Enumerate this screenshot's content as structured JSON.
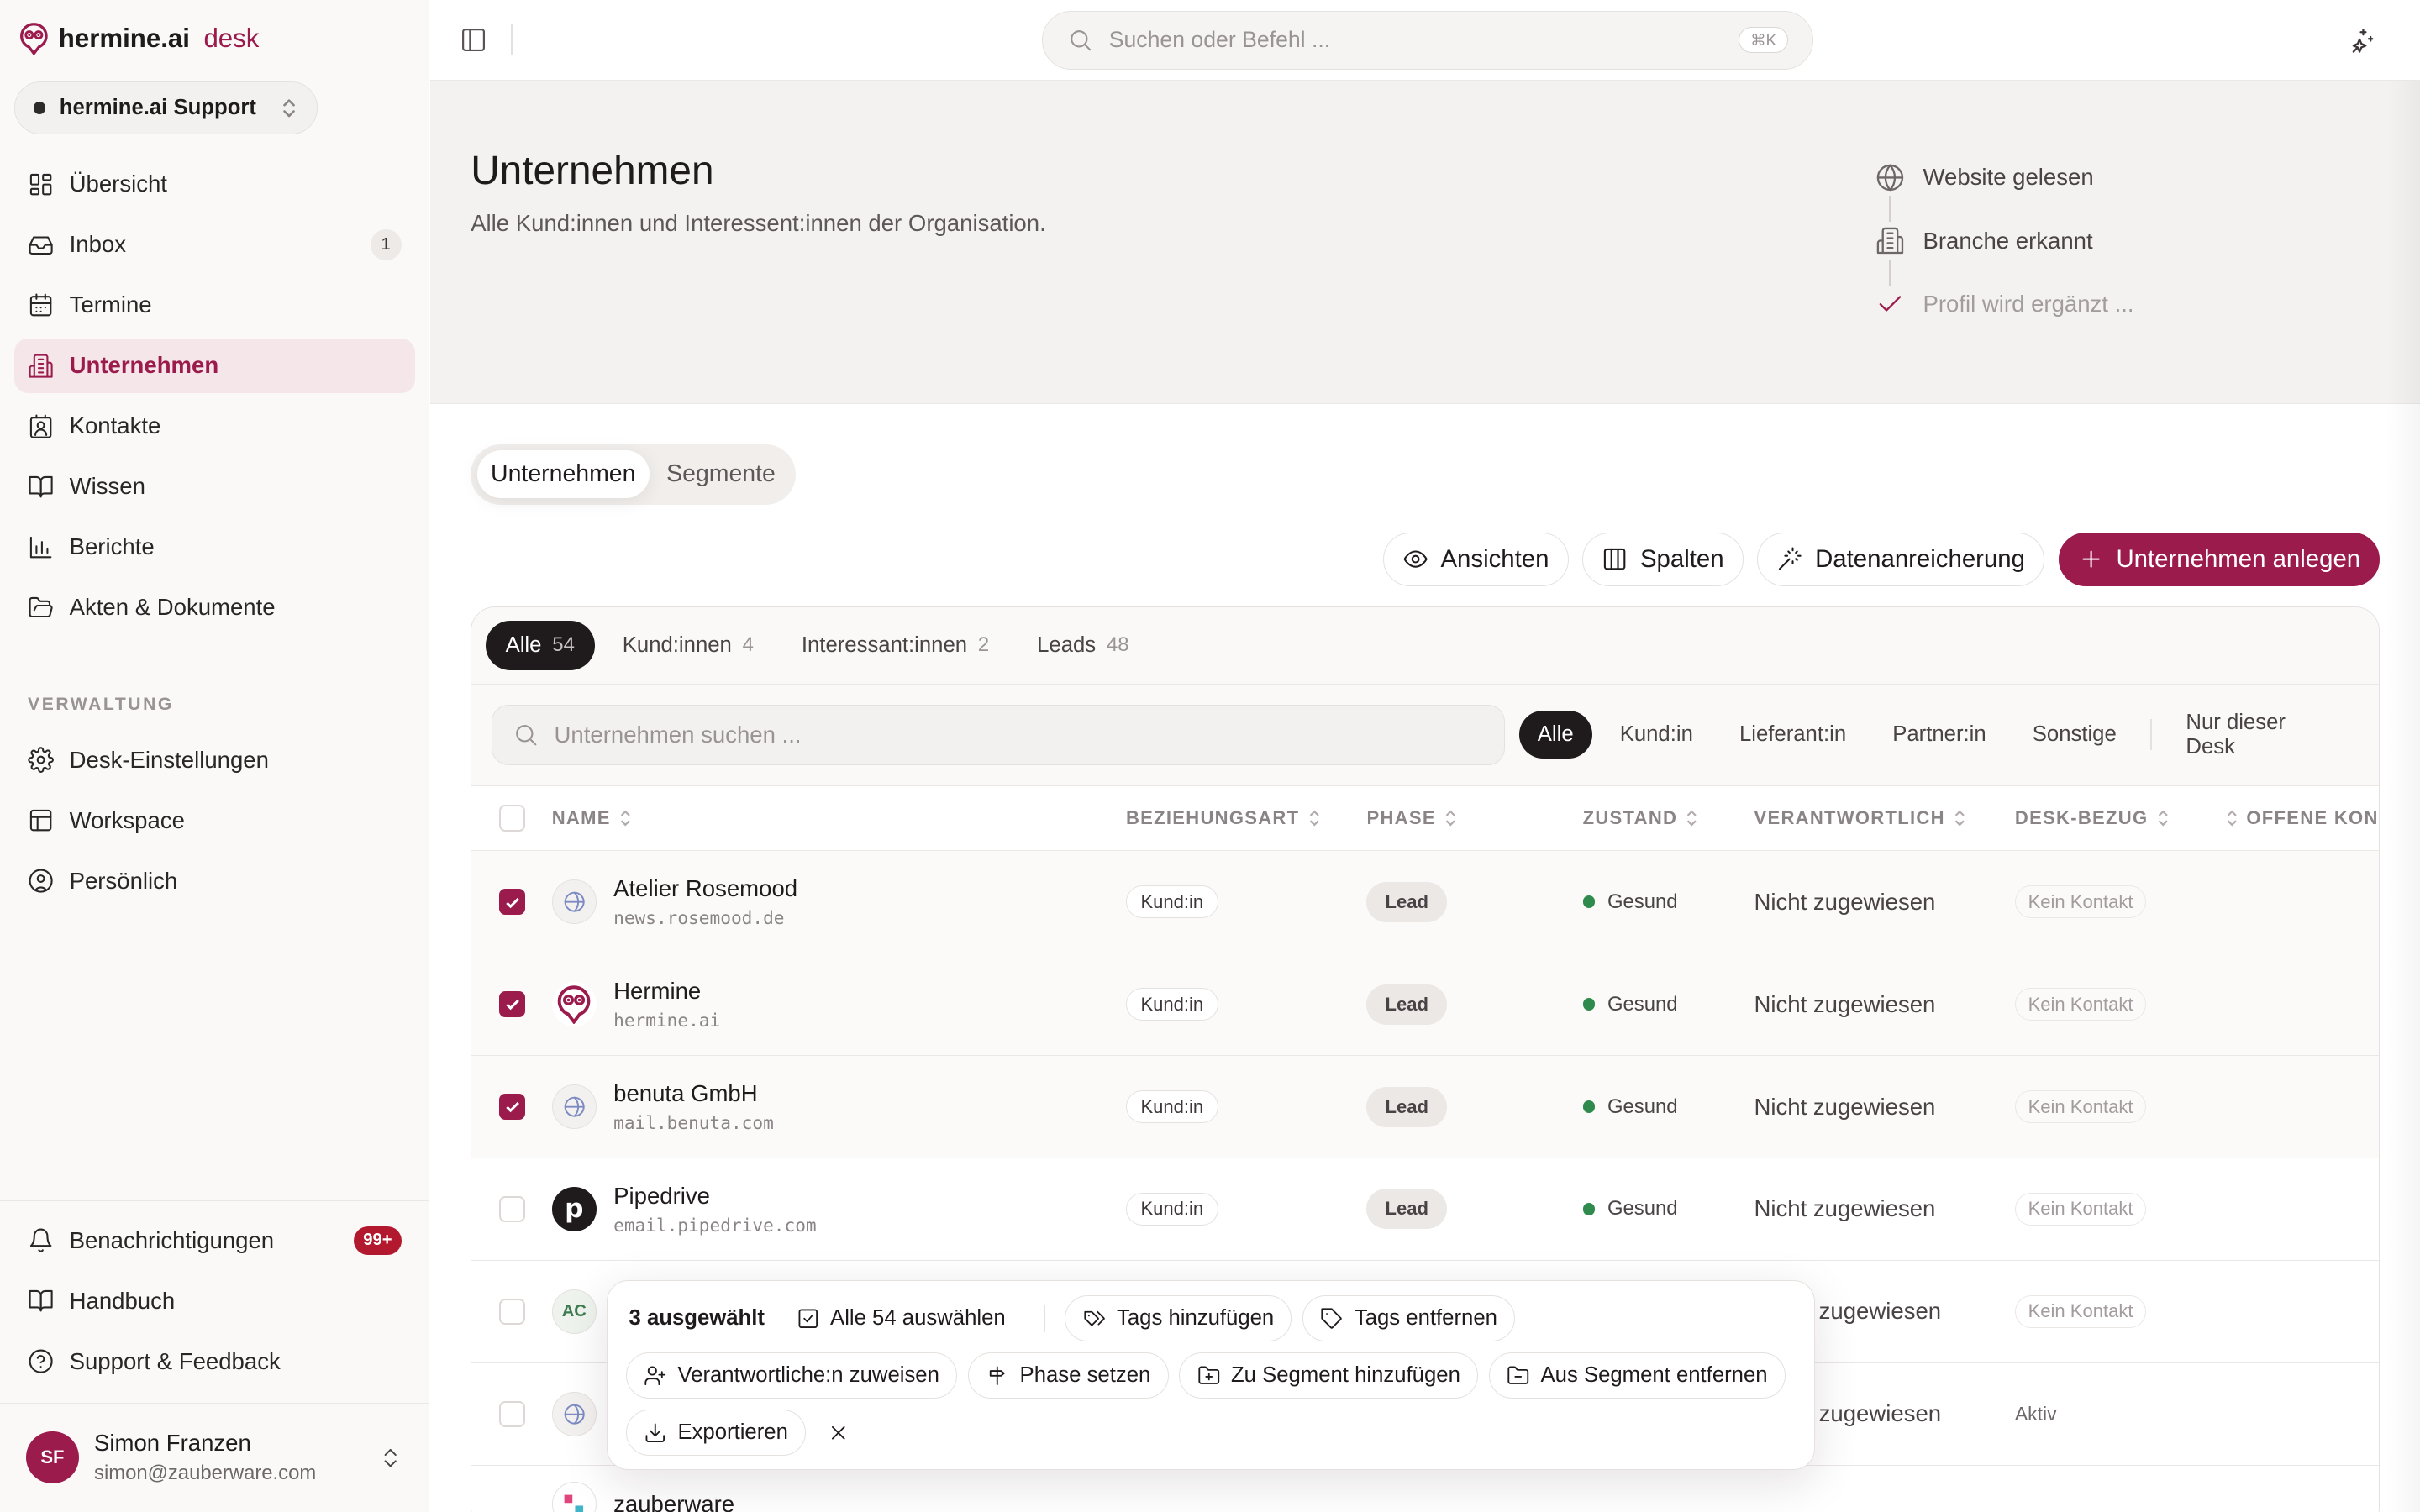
{
  "brand": {
    "name": "hermine.ai",
    "product": "desk"
  },
  "workspace": {
    "name": "hermine.ai Support"
  },
  "nav": [
    {
      "label": "Übersicht",
      "icon": "dashboard-icon"
    },
    {
      "label": "Inbox",
      "icon": "inbox-icon",
      "count": "1"
    },
    {
      "label": "Termine",
      "icon": "calendar-icon"
    },
    {
      "label": "Unternehmen",
      "icon": "building-icon",
      "active": true
    },
    {
      "label": "Kontakte",
      "icon": "contact-card-icon"
    },
    {
      "label": "Wissen",
      "icon": "book-open-icon"
    },
    {
      "label": "Berichte",
      "icon": "bar-chart-icon"
    },
    {
      "label": "Akten & Dokumente",
      "icon": "folder-open-icon"
    }
  ],
  "admin_section": {
    "label": "VERWALTUNG",
    "items": [
      {
        "label": "Desk-Einstellungen",
        "icon": "gear-icon"
      },
      {
        "label": "Workspace",
        "icon": "layout-icon"
      },
      {
        "label": "Persönlich",
        "icon": "user-circle-icon"
      }
    ]
  },
  "bottom_nav": [
    {
      "label": "Benachrichtigungen",
      "icon": "bell-icon",
      "badge": "99+"
    },
    {
      "label": "Handbuch",
      "icon": "book-icon"
    },
    {
      "label": "Support & Feedback",
      "icon": "help-circle-icon"
    }
  ],
  "user": {
    "initials": "SF",
    "name": "Simon Franzen",
    "email": "simon@zauberware.com"
  },
  "topbar": {
    "search_placeholder": "Suchen oder Befehl ...",
    "shortcut": "⌘K"
  },
  "header": {
    "title": "Unternehmen",
    "subtitle": "Alle Kund:innen und Interessent:innen der Organisation.",
    "steps": [
      {
        "label": "Website gelesen",
        "icon": "globe-icon"
      },
      {
        "label": "Branche erkannt",
        "icon": "building-icon"
      },
      {
        "label": "Profil wird ergänzt ...",
        "icon": "check-icon"
      }
    ]
  },
  "view_tabs": [
    {
      "label": "Unternehmen"
    },
    {
      "label": "Segmente"
    }
  ],
  "actions": {
    "views": "Ansichten",
    "columns": "Spalten",
    "enrich": "Datenanreicherung",
    "create": "Unternehmen anlegen"
  },
  "filter_tabs": [
    {
      "label": "Alle",
      "count": "54"
    },
    {
      "label": "Kund:innen",
      "count": "4"
    },
    {
      "label": "Interessant:innen",
      "count": "2"
    },
    {
      "label": "Leads",
      "count": "48"
    }
  ],
  "table_search_placeholder": "Unternehmen suchen ...",
  "type_chips": [
    "Alle",
    "Kund:in",
    "Lieferant:in",
    "Partner:in",
    "Sonstige"
  ],
  "desk_chip": "Nur dieser Desk",
  "columns": {
    "name": "NAME",
    "relation": "BEZIEHUNGSART",
    "phase": "PHASE",
    "state": "ZUSTAND",
    "owner": "VERANTWORTLICH",
    "desk": "DESK-BEZUG",
    "open": "OFFENE KONV"
  },
  "rows": [
    {
      "name": "Atelier Rosemood",
      "domain": "news.rosemood.de",
      "relation": "Kund:in",
      "phase": "Lead",
      "state": "Gesund",
      "owner": "Nicht zugewiesen",
      "desk": "Kein Kontakt",
      "checked": true
    },
    {
      "name": "Hermine",
      "domain": "hermine.ai",
      "relation": "Kund:in",
      "phase": "Lead",
      "state": "Gesund",
      "owner": "Nicht zugewiesen",
      "desk": "Kein Kontakt",
      "checked": true
    },
    {
      "name": "benuta GmbH",
      "domain": "mail.benuta.com",
      "relation": "Kund:in",
      "phase": "Lead",
      "state": "Gesund",
      "owner": "Nicht zugewiesen",
      "desk": "Kein Kontakt",
      "checked": true
    },
    {
      "name": "Pipedrive",
      "domain": "email.pipedrive.com",
      "relation": "Kund:in",
      "phase": "Lead",
      "state": "Gesund",
      "owner": "Nicht zugewiesen",
      "desk": "Kein Kontakt",
      "checked": false
    },
    {
      "logo_text": "AC",
      "owner_partial": "zugewiesen",
      "desk": "Kein Kontakt"
    },
    {
      "owner_partial": "zugewiesen",
      "desk": "Aktiv"
    },
    {
      "name": "zauberware"
    }
  ],
  "bulk": {
    "count": "3 ausgewählt",
    "select_all": "Alle 54 auswählen",
    "add_tags": "Tags hinzufügen",
    "remove_tags": "Tags entfernen",
    "assign": "Verantwortliche:n zuweisen",
    "set_phase": "Phase setzen",
    "add_segment": "Zu Segment hinzufügen",
    "remove_segment": "Aus Segment entfernen",
    "export": "Exportieren"
  },
  "colors": {
    "accent": "#9b1b4c",
    "healthy": "#2f8a4d",
    "badge": "#b3192e"
  }
}
